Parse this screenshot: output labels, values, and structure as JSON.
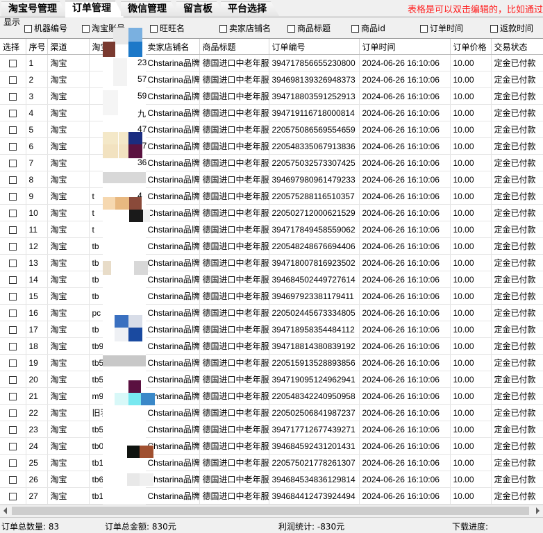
{
  "tabs": [
    {
      "label": "淘宝号管理",
      "active": false
    },
    {
      "label": "订单管理",
      "active": true
    },
    {
      "label": "微信管理",
      "active": false
    },
    {
      "label": "留言板",
      "active": false
    },
    {
      "label": "平台选择",
      "active": false
    }
  ],
  "notice": "表格是可以双击编辑的，比如通过",
  "display": {
    "label": "显示",
    "options": [
      "机器编号",
      "淘宝账号",
      "旺旺名",
      "卖家店铺名",
      "商品标题",
      "商品id",
      "订单时间",
      "返款时间"
    ]
  },
  "table": {
    "columns": [
      "选择",
      "序号",
      "渠道",
      "淘宝",
      "卖家店铺名",
      "商品标题",
      "订单编号",
      "订单时间",
      "订单价格",
      "交易状态"
    ],
    "rows": [
      {
        "no": "1",
        "channel": "淘宝",
        "account": "",
        "acct_tail": "23",
        "shop": "Chstarina品牌",
        "title": "德国进口中老年服",
        "order_id": "394717856655230800",
        "time": "2024-06-26 16:10:06",
        "price": "10.00",
        "status": "定金已付款"
      },
      {
        "no": "2",
        "channel": "淘宝",
        "account": "",
        "acct_tail": "57",
        "shop": "Chstarina品牌",
        "title": "德国进口中老年服",
        "order_id": "394698139326948373",
        "time": "2024-06-26 16:10:06",
        "price": "10.00",
        "status": "定金已付款"
      },
      {
        "no": "3",
        "channel": "淘宝",
        "account": "",
        "acct_tail": "59",
        "shop": "Chstarina品牌",
        "title": "德国进口中老年服",
        "order_id": "394718803591252913",
        "time": "2024-06-26 16:10:06",
        "price": "10.00",
        "status": "定金已付款"
      },
      {
        "no": "4",
        "channel": "淘宝",
        "account": "",
        "acct_tail": "九",
        "shop": "Chstarina品牌",
        "title": "德国进口中老年服",
        "order_id": "394719116718000814",
        "time": "2024-06-26 16:10:06",
        "price": "10.00",
        "status": "定金已付款"
      },
      {
        "no": "5",
        "channel": "淘宝",
        "account": "",
        "acct_tail": "47",
        "shop": "Chstarina品牌",
        "title": "德国进口中老年服",
        "order_id": "220575086569554659",
        "time": "2024-06-26 16:10:06",
        "price": "10.00",
        "status": "定金已付款"
      },
      {
        "no": "6",
        "channel": "淘宝",
        "account": "",
        "acct_tail": "07",
        "shop": "Chstarina品牌",
        "title": "德国进口中老年服",
        "order_id": "220548335067913836",
        "time": "2024-06-26 16:10:06",
        "price": "10.00",
        "status": "定金已付款"
      },
      {
        "no": "7",
        "channel": "淘宝",
        "account": "",
        "acct_tail": "36",
        "shop": "Chstarina品牌",
        "title": "德国进口中老年服",
        "order_id": "220575032573307425",
        "time": "2024-06-26 16:10:06",
        "price": "10.00",
        "status": "定金已付款"
      },
      {
        "no": "8",
        "channel": "淘宝",
        "account": "",
        "acct_tail": "",
        "shop": "Chstarina品牌",
        "title": "德国进口中老年服",
        "order_id": "394697980961479233",
        "time": "2024-06-26 16:10:06",
        "price": "10.00",
        "status": "定金已付款"
      },
      {
        "no": "9",
        "channel": "淘宝",
        "account": "t",
        "acct_tail": "4",
        "shop": "Chstarina品牌",
        "title": "德国进口中老年服",
        "order_id": "220575288116510357",
        "time": "2024-06-26 16:10:06",
        "price": "10.00",
        "status": "定金已付款"
      },
      {
        "no": "10",
        "channel": "淘宝",
        "account": "t",
        "acct_tail": "",
        "shop": "Chstarina品牌",
        "title": "德国进口中老年服",
        "order_id": "220502712000621529",
        "time": "2024-06-26 16:10:06",
        "price": "10.00",
        "status": "定金已付款"
      },
      {
        "no": "11",
        "channel": "淘宝",
        "account": "t",
        "acct_tail": "",
        "shop": "Chstarina品牌",
        "title": "德国进口中老年服",
        "order_id": "394717849458559062",
        "time": "2024-06-26 16:10:06",
        "price": "10.00",
        "status": "定金已付款"
      },
      {
        "no": "12",
        "channel": "淘宝",
        "account": "tb",
        "acct_tail": "",
        "shop": "Chstarina品牌",
        "title": "德国进口中老年服",
        "order_id": "220548248676694406",
        "time": "2024-06-26 16:10:06",
        "price": "10.00",
        "status": "定金已付款"
      },
      {
        "no": "13",
        "channel": "淘宝",
        "account": "tb",
        "acct_tail": "",
        "shop": "Chstarina品牌",
        "title": "德国进口中老年服",
        "order_id": "394718007816923502",
        "time": "2024-06-26 16:10:06",
        "price": "10.00",
        "status": "定金已付款"
      },
      {
        "no": "14",
        "channel": "淘宝",
        "account": "tb",
        "acct_tail": "",
        "shop": "Chstarina品牌",
        "title": "德国进口中老年服",
        "order_id": "394684502449727614",
        "time": "2024-06-26 16:10:06",
        "price": "10.00",
        "status": "定金已付款"
      },
      {
        "no": "15",
        "channel": "淘宝",
        "account": "tb",
        "acct_tail": "",
        "shop": "Chstarina品牌",
        "title": "德国进口中老年服",
        "order_id": "394697923381179411",
        "time": "2024-06-26 16:10:06",
        "price": "10.00",
        "status": "定金已付款"
      },
      {
        "no": "16",
        "channel": "淘宝",
        "account": "pc",
        "acct_tail": "",
        "shop": "Chstarina品牌",
        "title": "德国进口中老年服",
        "order_id": "220502445673334805",
        "time": "2024-06-26 16:10:06",
        "price": "10.00",
        "status": "定金已付款"
      },
      {
        "no": "17",
        "channel": "淘宝",
        "account": "tb",
        "acct_tail": "",
        "shop": "Chstarina品牌",
        "title": "德国进口中老年服",
        "order_id": "394718958354484112",
        "time": "2024-06-26 16:10:06",
        "price": "10.00",
        "status": "定金已付款"
      },
      {
        "no": "18",
        "channel": "淘宝",
        "account": "tb9",
        "acct_tail": "",
        "shop": "Chstarina品牌",
        "title": "德国进口中老年服",
        "order_id": "394718814380839192",
        "time": "2024-06-26 16:10:06",
        "price": "10.00",
        "status": "定金已付款"
      },
      {
        "no": "19",
        "channel": "淘宝",
        "account": "tb5",
        "acct_tail": "",
        "shop": "Chstarina品牌",
        "title": "德国进口中老年服",
        "order_id": "220515913528893856",
        "time": "2024-06-26 16:10:06",
        "price": "10.00",
        "status": "定金已付款"
      },
      {
        "no": "20",
        "channel": "淘宝",
        "account": "tb5",
        "acct_tail": "",
        "shop": "Chstarina品牌",
        "title": "德国进口中老年服",
        "order_id": "394719095124962941",
        "time": "2024-06-26 16:10:06",
        "price": "10.00",
        "status": "定金已付款"
      },
      {
        "no": "21",
        "channel": "淘宝",
        "account": "m9",
        "acct_tail": "",
        "shop": "Chstarina品牌",
        "title": "德国进口中老年服",
        "order_id": "220548342240950958",
        "time": "2024-06-26 16:10:06",
        "price": "10.00",
        "status": "定金已付款"
      },
      {
        "no": "22",
        "channel": "淘宝",
        "account": "旧羽",
        "acct_tail": "",
        "shop": "Chstarina品牌",
        "title": "德国进口中老年服",
        "order_id": "220502506841987237",
        "time": "2024-06-26 16:10:06",
        "price": "10.00",
        "status": "定金已付款"
      },
      {
        "no": "23",
        "channel": "淘宝",
        "account": "tb5",
        "acct_tail": "",
        "shop": "Chstarina品牌",
        "title": "德国进口中老年服",
        "order_id": "394717712677439271",
        "time": "2024-06-26 16:10:06",
        "price": "10.00",
        "status": "定金已付款"
      },
      {
        "no": "24",
        "channel": "淘宝",
        "account": "tb0",
        "acct_tail": "",
        "shop": "Chstarina品牌",
        "title": "德国进口中老年服",
        "order_id": "394684592431201431",
        "time": "2024-06-26 16:10:06",
        "price": "10.00",
        "status": "定金已付款"
      },
      {
        "no": "25",
        "channel": "淘宝",
        "account": "tb1",
        "acct_tail": "",
        "shop": "Chstarina品牌",
        "title": "德国进口中老年服",
        "order_id": "220575021778261307",
        "time": "2024-06-26 16:10:06",
        "price": "10.00",
        "status": "定金已付款"
      },
      {
        "no": "26",
        "channel": "淘宝",
        "account": "tb6",
        "acct_tail": "",
        "shop": "Chstarina品牌",
        "title": "德国进口中老年服",
        "order_id": "394684534836129814",
        "time": "2024-06-26 16:10:06",
        "price": "10.00",
        "status": "定金已付款"
      },
      {
        "no": "27",
        "channel": "淘宝",
        "account": "tb1",
        "acct_tail": "",
        "shop": "Chstarina品牌",
        "title": "德国进口中老年服",
        "order_id": "394684412473924494",
        "time": "2024-06-26 16:10:06",
        "price": "10.00",
        "status": "定金已付款"
      }
    ]
  },
  "status": {
    "total_orders": "订单总数量: 83",
    "total_amount": "订单总金额: 830元",
    "profit": "利润统计: -830元",
    "download": "下载进度:"
  },
  "colors": {
    "notice": "#ff1e1e",
    "grid_bg": "#ffffff",
    "window_bg": "#f0f0f0"
  }
}
